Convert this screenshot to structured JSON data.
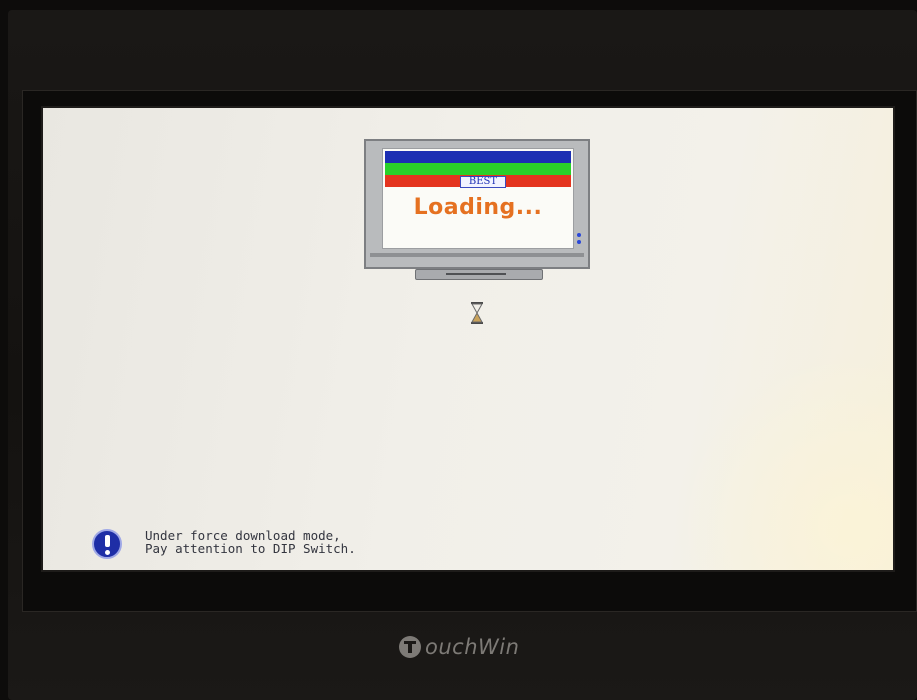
{
  "splash": {
    "banner_label": "BEST",
    "status_text": "Loading..."
  },
  "notice": {
    "line1": "Under force download mode,",
    "line2": "Pay attention to DIP Switch."
  },
  "device": {
    "brand": "ouchWin"
  },
  "icons": {
    "info": "info-exclamation-icon",
    "hourglass": "hourglass-icon",
    "brand_logo": "touchwin-logo-icon"
  },
  "colors": {
    "bar_blue": "#1c2fb3",
    "bar_green": "#2ad02a",
    "bar_red": "#e4341f",
    "loading_orange": "#e57121",
    "info_blue": "#1e2ea6"
  }
}
